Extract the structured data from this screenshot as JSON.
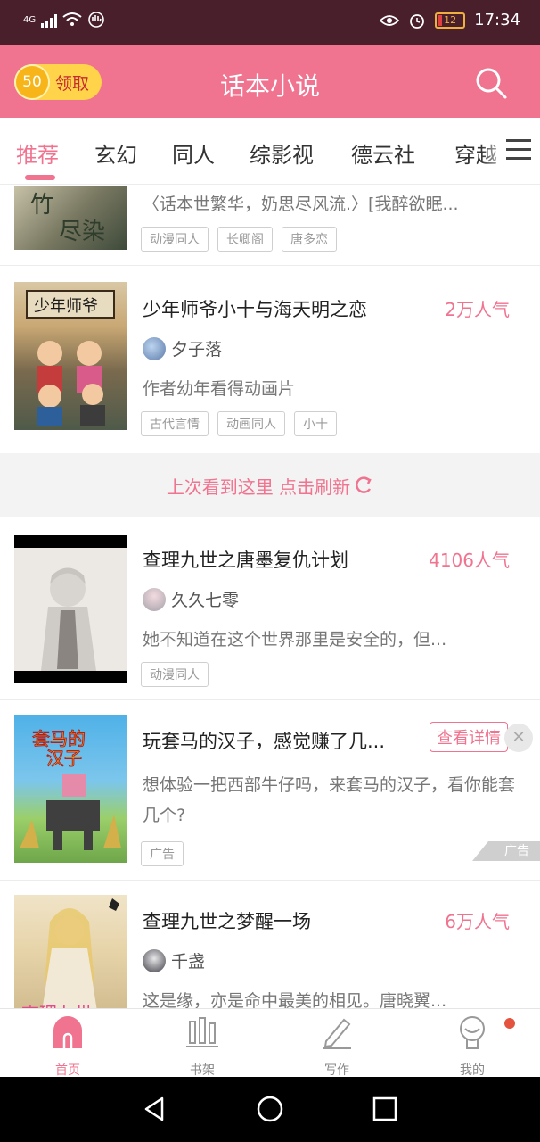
{
  "status_bar": {
    "network": "4G",
    "battery": "12",
    "time": "17:34"
  },
  "header": {
    "coin_value": "50",
    "coin_label": "领取",
    "title": "话本小说"
  },
  "tabs": [
    {
      "label": "推荐",
      "active": true
    },
    {
      "label": "玄幻"
    },
    {
      "label": "同人"
    },
    {
      "label": "综影视"
    },
    {
      "label": "德云社"
    },
    {
      "label": "穿越"
    }
  ],
  "items": [
    {
      "desc": "〈话本世繁华，奶思尽风流.〉[我醉欲眠...",
      "tags": [
        "动漫同人",
        "长卿阁",
        "唐多恋"
      ]
    },
    {
      "title": "少年师爷小十与海天明之恋",
      "heat": "2万人气",
      "author": "夕子落",
      "desc": "作者幼年看得动画片",
      "tags": [
        "古代言情",
        "动画同人",
        "小十"
      ]
    },
    {
      "title": "查理九世之唐墨复仇计划",
      "heat": "4106人气",
      "author": "久久七零",
      "desc": "她不知道在这个世界那里是安全的，但...",
      "tags": [
        "动漫同人"
      ]
    },
    {
      "title": "查理九世之梦醒一场",
      "heat": "6万人气",
      "author": "千盏",
      "desc": "这是缘，亦是命中最美的相见。唐晓翼..."
    }
  ],
  "refresh": {
    "label": "上次看到这里 点击刷新"
  },
  "ad": {
    "title": "玩套马的汉子，感觉赚了几...",
    "detail_label": "查看详情",
    "desc": "想体验一把西部牛仔吗，来套马的汉子，看你能套几个?",
    "tag": "广告",
    "mark": "广告"
  },
  "bottom_nav": [
    {
      "label": "首页",
      "active": true
    },
    {
      "label": "书架"
    },
    {
      "label": "写作"
    },
    {
      "label": "我的"
    }
  ],
  "colors": {
    "accent": "#f0738f",
    "status_bar": "#4a1f2c"
  }
}
